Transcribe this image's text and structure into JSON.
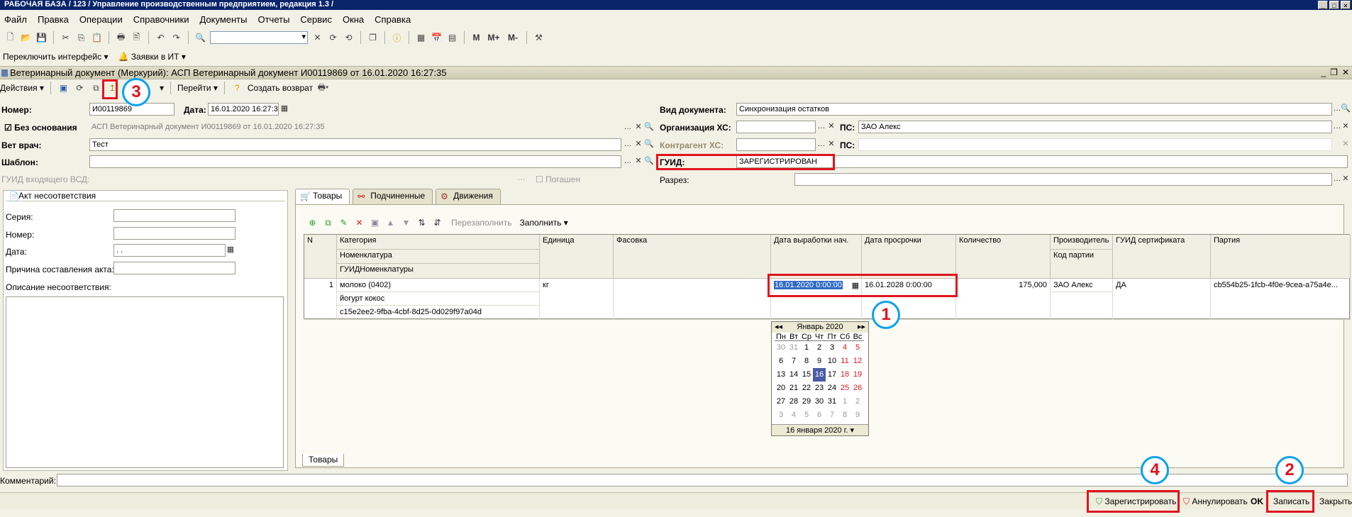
{
  "window": {
    "title": "РАБОЧАЯ БАЗА / 123 / Управление производственным предприятием, редакция 1.3 /"
  },
  "menu": [
    "Файл",
    "Правка",
    "Операции",
    "Справочники",
    "Документы",
    "Отчеты",
    "Сервис",
    "Окна",
    "Справка"
  ],
  "toolbar2": {
    "switch_interface": "Переключить интерфейс",
    "it_requests": "Заявки в ИТ"
  },
  "document": {
    "title": "Ветеринарный документ (Меркурий): АСП Ветеринарный документ И00119869 от 16.01.2020 16:27:35",
    "actions": "Действия",
    "go": "Перейти",
    "create_return": "Создать возврат",
    "number_label": "Номер:",
    "number": "И00119869",
    "date_label": "Дата:",
    "date": "16.01.2020 16:27:35",
    "no_basis_label": "Без основания",
    "basis_value": "АСП Ветеринарный документ И00119869 от 16.01.2020 16:27:35",
    "vet_label": "Вет врач:",
    "vet": "Тест",
    "template_label": "Шаблон:",
    "incoming_guid_label": "ГУИД входящего ВСД:",
    "extinguished_label": "Погашен",
    "doc_type_label": "Вид документа:",
    "doc_type": "Синхронизация остатков",
    "org_label": "Организация ХС:",
    "ps_label": "ПС:",
    "ps": "ЗАО Алекс",
    "contractor_label": "Контрагент ХС:",
    "ps2_label": "ПС:",
    "guid_label": "ГУИД:",
    "guid": "ЗАРЕГИСТРИРОВАН",
    "section_label": "Разрез:"
  },
  "left_panel": {
    "title": "Акт несоответствия",
    "series_label": "Серия:",
    "number_label": "Номер:",
    "date_label": "Дата:",
    "date_value": " . .",
    "reason_label": "Причина составления акта:",
    "description_label": "Описание несоответствия:"
  },
  "tabs": [
    "Товары",
    "Подчиненные",
    "Движения"
  ],
  "grid_toolbar": {
    "refill": "Перезаполнить",
    "fill": "Заполнить"
  },
  "grid": {
    "headers": {
      "n": "N",
      "category": "Категория",
      "nomenclature": "Номенклатура",
      "guid_nom": "ГУИДНоменклатуры",
      "unit": "Единица",
      "packing": "Фасовка",
      "prod_start": "Дата выработки нач.",
      "expiry": "Дата просрочки",
      "qty": "Количество",
      "producer": "Производитель",
      "batch_code": "Код партии",
      "cert_guid": "ГУИД сертификата",
      "batch": "Партия"
    },
    "row": {
      "n": "1",
      "category": "молоко (0402)",
      "nomenclature": "йогурт кокос",
      "guid_nom": "c15e2ee2-9fba-4cbf-8d25-0d029f97a04d",
      "unit": "кг",
      "prod_start": "16.01.2020  0:00:00",
      "expiry": "16.01.2028 0:00:00",
      "qty": "175,000",
      "producer": "ЗАО Алекс",
      "cert_guid": "ДА",
      "batch": "cb554b25-1fcb-4f0e-9cea-a75a4e..."
    }
  },
  "calendar": {
    "month": "Январь 2020",
    "weekdays": [
      "Пн",
      "Вт",
      "Ср",
      "Чт",
      "Пт",
      "Сб",
      "Вс"
    ],
    "days": [
      "30",
      "31",
      "1",
      "2",
      "3",
      "4",
      "5",
      "6",
      "7",
      "8",
      "9",
      "10",
      "11",
      "12",
      "13",
      "14",
      "15",
      "16",
      "17",
      "18",
      "19",
      "20",
      "21",
      "22",
      "23",
      "24",
      "25",
      "26",
      "27",
      "28",
      "29",
      "30",
      "31",
      "1",
      "2",
      "3",
      "4",
      "5",
      "6",
      "7",
      "8",
      "9"
    ],
    "footer": "16 января 2020 г."
  },
  "bottom_tab": "Товары",
  "comment_label": "Комментарий:",
  "buttons": {
    "register": "Зарегистрировать",
    "cancel": "Аннулировать",
    "ok": "OK",
    "save": "Записать",
    "close": "Закрыть"
  },
  "badges": [
    "1",
    "2",
    "3",
    "4"
  ]
}
